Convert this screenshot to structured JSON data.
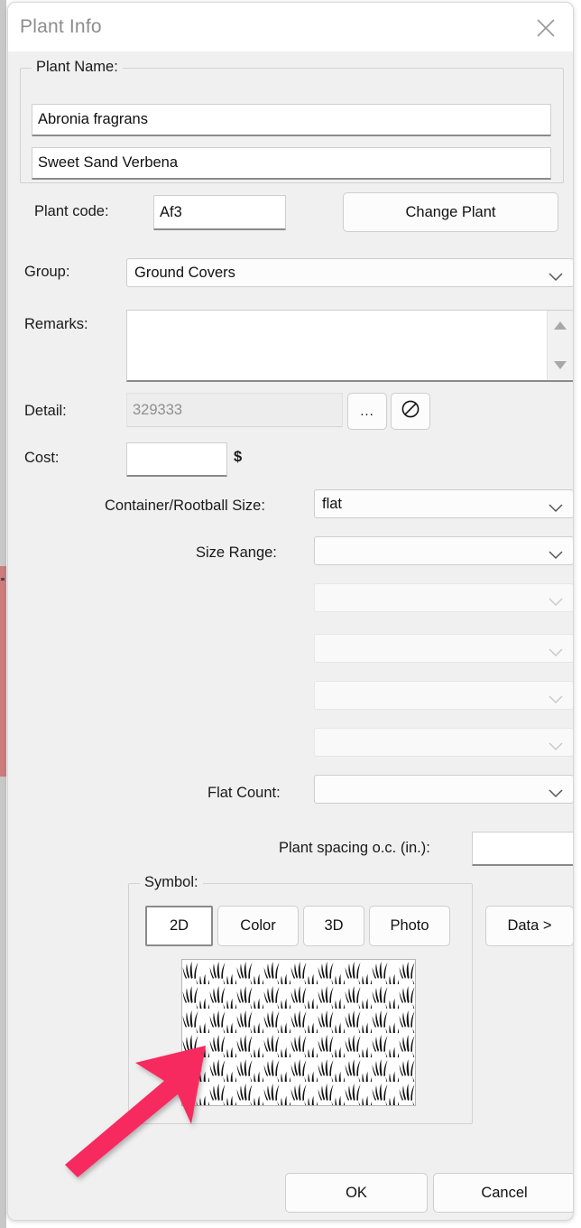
{
  "window": {
    "title": "Plant Info",
    "close_icon": "close-icon"
  },
  "plant_name_group": {
    "legend": "Plant Name:",
    "botanical_name": "Abronia fragrans",
    "common_name": "Sweet Sand Verbena",
    "plant_code_label": "Plant code:",
    "plant_code_value": "Af3",
    "change_plant_button": "Change Plant"
  },
  "fields": {
    "group_label": "Group:",
    "group_value": "Ground Covers",
    "remarks_label": "Remarks:",
    "remarks_value": "",
    "detail_label": "Detail:",
    "detail_value": "329333",
    "detail_browse_button": "...",
    "detail_clear_icon": "no-entry-icon",
    "cost_label": "Cost:",
    "cost_value": "",
    "cost_currency": "$",
    "container_size_label": "Container/Rootball Size:",
    "container_size_value": "flat",
    "size_range_label": "Size Range:",
    "size_range_value": "",
    "extra_dropdowns": [
      "",
      "",
      "",
      ""
    ],
    "flat_count_label": "Flat Count:",
    "flat_count_value": "",
    "plant_spacing_label": "Plant spacing o.c. (in.):",
    "plant_spacing_value": ""
  },
  "symbol_group": {
    "legend": "Symbol:",
    "tabs": [
      {
        "label": "2D",
        "selected": true
      },
      {
        "label": "Color",
        "selected": false
      },
      {
        "label": "3D",
        "selected": false
      },
      {
        "label": "Photo",
        "selected": false
      }
    ],
    "data_button": "Data >",
    "preview_pattern": "grass-tuft-hatch-pattern"
  },
  "footer": {
    "ok_button": "OK",
    "cancel_button": "Cancel"
  },
  "annotation": {
    "arrow_color": "#F72C5F",
    "arrow_points_to": "symbol-preview"
  },
  "colors": {
    "dialog_background": "#f0f0f0",
    "titlebar_background": "#ffffff",
    "title_text": "#8d8d8d",
    "accent_annotation": "#F72C5F",
    "backdrop_red_strip": "#cd7b7b"
  }
}
